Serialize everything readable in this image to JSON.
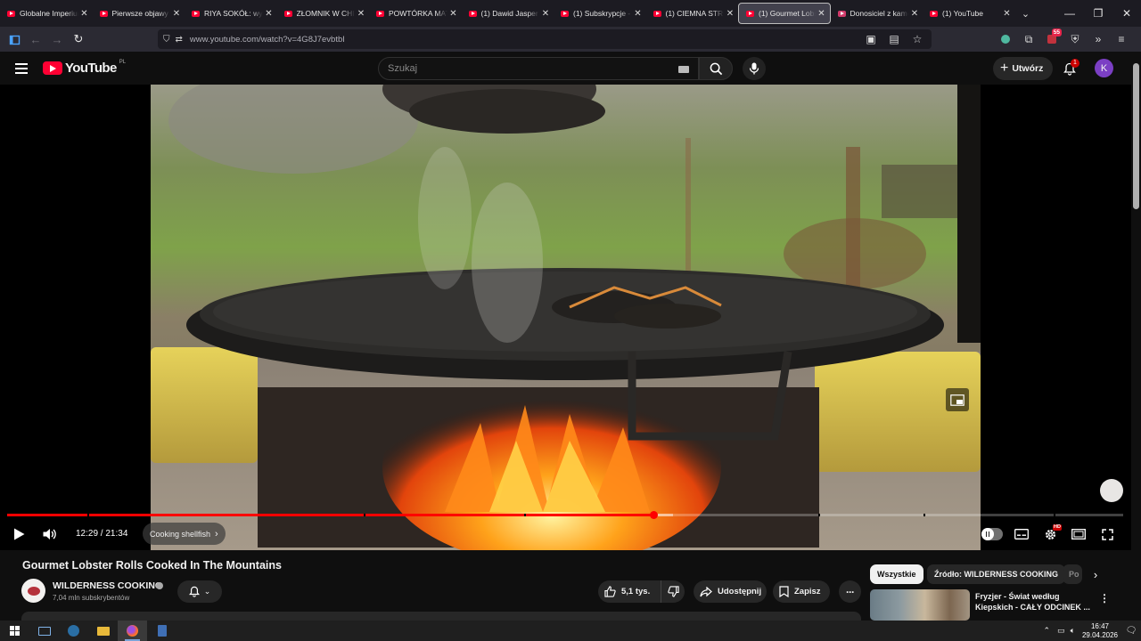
{
  "browser": {
    "tabs": [
      {
        "title": "Globalne Imperium",
        "icon": "youtube-favicon"
      },
      {
        "title": "Pierwsze objawy R",
        "icon": "youtube-favicon"
      },
      {
        "title": "RIYA SOKÓŁ: wywi",
        "icon": "youtube-favicon"
      },
      {
        "title": "ZŁOMNIK W CHIN",
        "icon": "youtube-favicon"
      },
      {
        "title": "POWTÓRKA MATU",
        "icon": "youtube-favicon"
      },
      {
        "title": "(1) Dawid Jasper V",
        "icon": "youtube-favicon"
      },
      {
        "title": "(1) Subskrypcje - Y",
        "icon": "youtube-favicon"
      },
      {
        "title": "(1) CIEMNA STRO",
        "icon": "youtube-favicon"
      },
      {
        "title": "(1) Gourmet Lobst",
        "icon": "youtube-favicon",
        "active": true
      },
      {
        "title": "Donosiciel z kame",
        "icon": "pink-favicon"
      },
      {
        "title": "(1) YouTube",
        "icon": "youtube-favicon"
      }
    ],
    "url": "www.youtube.com/watch?v=4G8J7evbtbI",
    "extension_badge": "55"
  },
  "youtube": {
    "logo_text": "YouTube",
    "country_code": "PL",
    "search_placeholder": "Szukaj",
    "create_label": "Utwórz",
    "notifications_count": "1",
    "avatar_letter": "K"
  },
  "player": {
    "current_time": "12:29",
    "duration": "21:34",
    "time_display": "12:29 / 21:34",
    "progress_fraction": 0.579,
    "buffer_fraction": 0.597,
    "chapter": "Cooking shellfish"
  },
  "video": {
    "title": "Gourmet Lobster Rolls Cooked In The Mountains",
    "channel_name": "WILDERNESS COOKING",
    "subscribers": "7,04 mln subskrybentów",
    "likes": "5,1 tys.",
    "share_label": "Udostępnij",
    "save_label": "Zapisz"
  },
  "sidebar": {
    "chips": [
      "Wszystkie",
      "Źródło: WILDERNESS COOKING",
      "Po"
    ],
    "recommendation": {
      "title": "Fryzjer - Świat według Kiepskich - CAŁY ODCINEK ..."
    }
  },
  "taskbar": {
    "time": "16:47",
    "date": "29.04.2026"
  }
}
